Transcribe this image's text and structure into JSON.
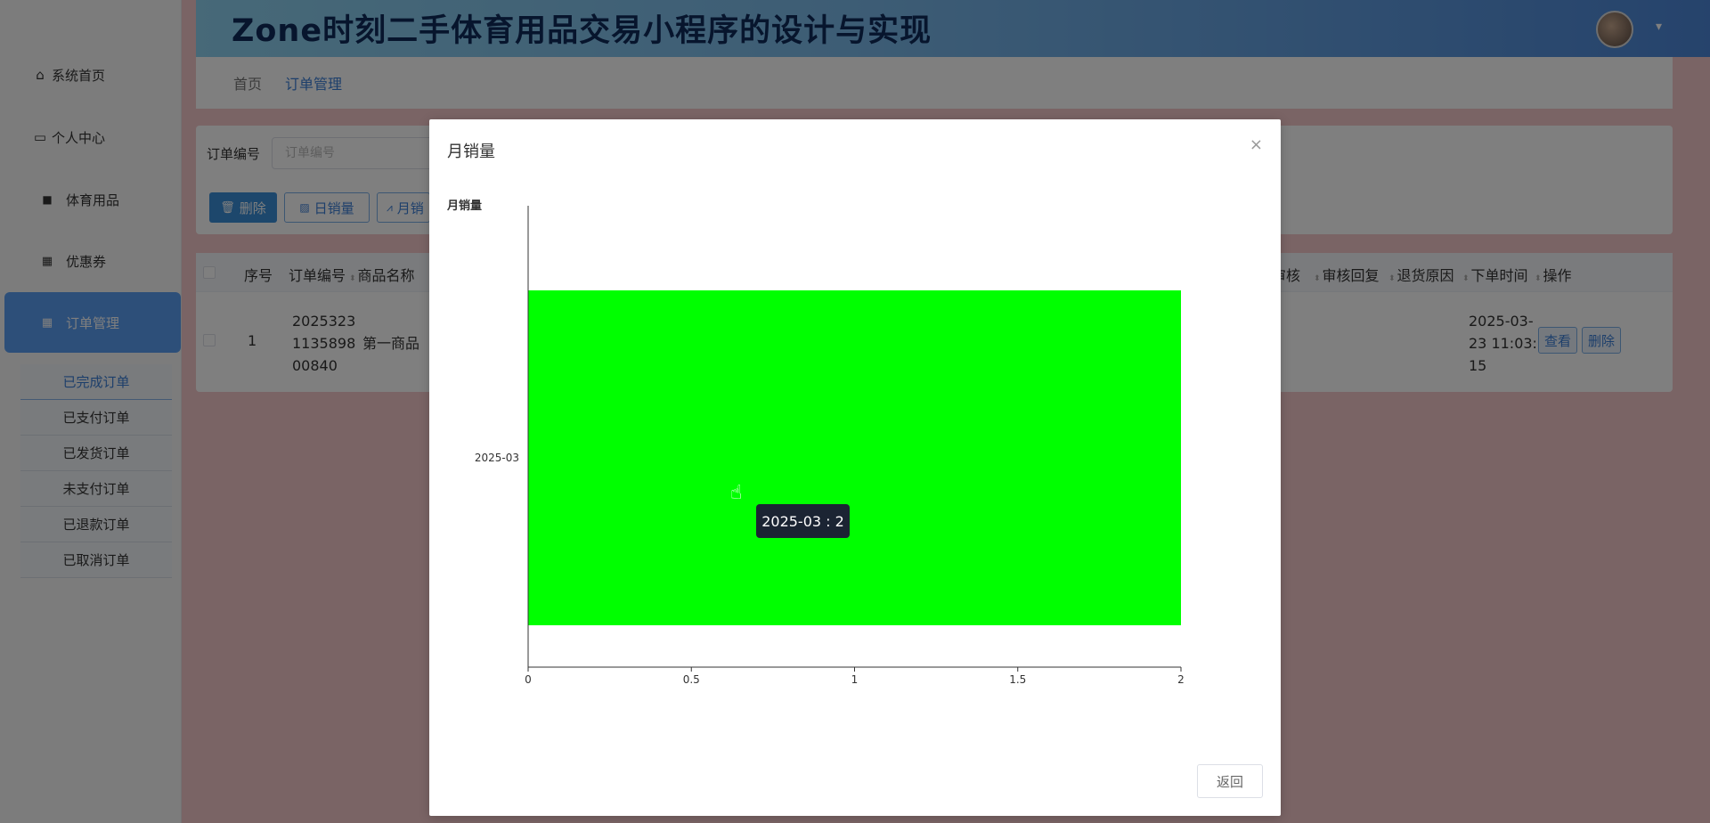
{
  "sidebar": {
    "items": [
      {
        "label": "系统首页",
        "icon": "home-icon"
      },
      {
        "label": "个人中心",
        "icon": "user-card-icon"
      },
      {
        "label": "体育用品",
        "icon": "chat-icon"
      },
      {
        "label": "优惠券",
        "icon": "grid-icon"
      },
      {
        "label": "订单管理",
        "icon": "grid-icon"
      }
    ],
    "submenu": [
      "已完成订单",
      "已支付订单",
      "已发货订单",
      "未支付订单",
      "已退款订单",
      "已取消订单"
    ]
  },
  "header": {
    "title": "Zone时刻二手体育用品交易小程序的设计与实现",
    "caret": "▾"
  },
  "breadcrumb": {
    "home": "首页",
    "current": "订单管理"
  },
  "filter": {
    "order_no_label": "订单编号",
    "order_no_placeholder": "订单编号",
    "delete_label": "删除",
    "day_sales_label": "日销量",
    "month_sales_label": "月销"
  },
  "table": {
    "headers": {
      "seq": "序号",
      "order_no": "订单编号",
      "product_name": "商品名称",
      "audit": "审核",
      "audit_reply": "审核回复",
      "return_reason": "退货原因",
      "order_time": "下单时间",
      "actions": "操作"
    },
    "rows": [
      {
        "seq": "1",
        "order_no_lines": [
          "2025323",
          "1135898",
          "00840"
        ],
        "product_name": "第一商品",
        "order_time_lines": [
          "2025-03-",
          "23 11:03:",
          "15"
        ],
        "view_label": "查看",
        "delete_label": "删除"
      }
    ]
  },
  "modal": {
    "title": "月销量",
    "close": "×",
    "chart_title": "月销量",
    "back_label": "返回",
    "tooltip": "2025-03 : 2"
  },
  "colors": {
    "bar": "#00ff00",
    "accent": "#3b7ed6"
  },
  "chart_data": {
    "type": "bar",
    "orientation": "horizontal",
    "title": "月销量",
    "categories": [
      "2025-03"
    ],
    "values": [
      2
    ],
    "xlim": [
      0,
      2
    ],
    "x_ticks": [
      0,
      0.5,
      1,
      1.5,
      2
    ],
    "xlabel": "",
    "ylabel": "",
    "grid": false,
    "legend": "none"
  }
}
